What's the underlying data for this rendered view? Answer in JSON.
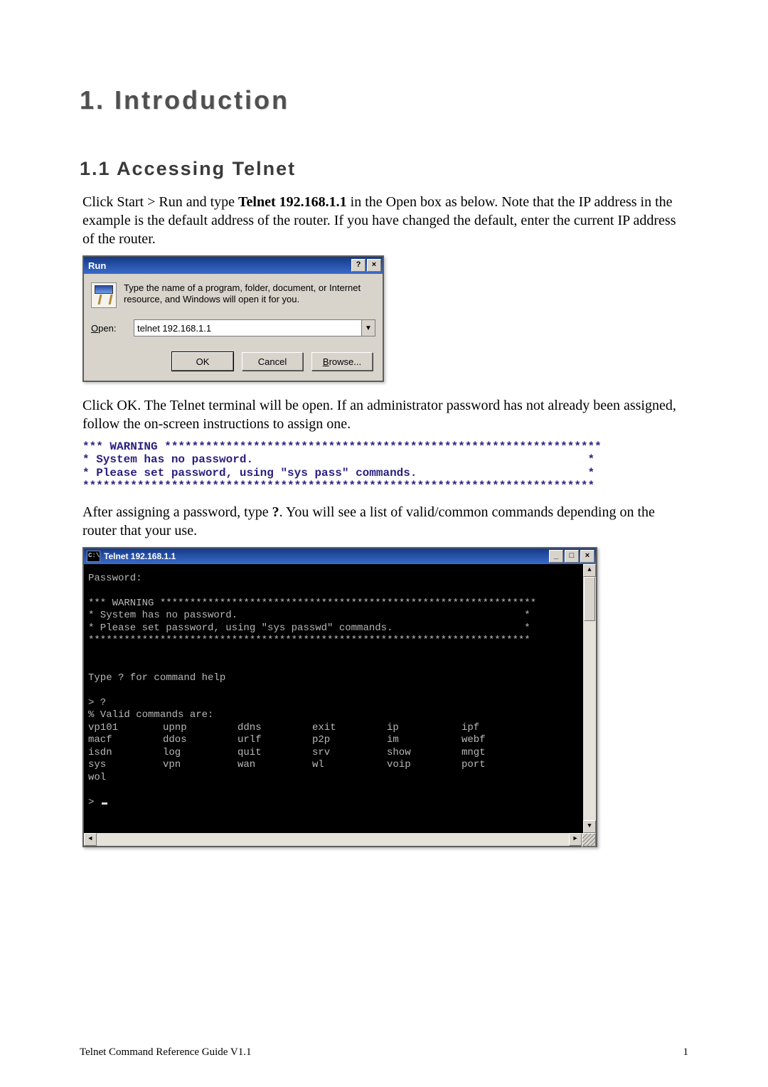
{
  "heading_chapter": "1. Introduction",
  "heading_section": "1.1 Accessing Telnet",
  "para1_pre": "Click Start > Run and type ",
  "para1_bold": "Telnet 192.168.1.1",
  "para1_post": " in the Open box as below. Note that the IP address in the example is the default address of the router. If you have changed the default, enter the current IP address of the router.",
  "run_dialog": {
    "title": "Run",
    "help_btn": "?",
    "close_btn": "×",
    "desc": "Type the name of a program, folder, document, or Internet resource, and Windows will open it for you.",
    "open_char": "O",
    "open_rest": "pen:",
    "input_value": "telnet 192.168.1.1",
    "dropdown_glyph": "▼",
    "btn_ok": "OK",
    "btn_cancel": "Cancel",
    "btn_browse_char": "B",
    "btn_browse_rest": "rowse..."
  },
  "para2": "Click OK. The Telnet terminal will be open. If an administrator password has not already been assigned, follow the on-screen instructions to assign one.",
  "warn_small": "*** WARNING ****************************************************************\n* System has no password.                                                 *\n* Please set password, using \"sys pass\" commands.                         *\n***************************************************************************",
  "para3_pre": "After assigning a password, type ",
  "para3_bold": "?",
  "para3_post": ". You will see a list of valid/common commands depending on the router that your use.",
  "console": {
    "icon_text": "C:\\",
    "title": "Telnet 192.168.1.1",
    "min_btn": "_",
    "max_btn": "□",
    "close_btn": "×",
    "scroll_up": "▲",
    "scroll_down": "▼",
    "scroll_left": "◄",
    "scroll_right": "►",
    "line_password": "Password:",
    "warn_top": "*** WARNING ***************************************************************",
    "warn_l1": "* System has no password.                                                *",
    "warn_l2": "* Please set password, using \"sys passwd\" commands.                      *",
    "warn_bot": "**************************************************************************",
    "help_hint": "Type ? for command help",
    "prompt1": "> ?",
    "valid_hdr": "% Valid commands are:",
    "rows": [
      [
        "vp101",
        "upnp",
        "ddns",
        "exit",
        "ip",
        "ipf"
      ],
      [
        "macf",
        "ddos",
        "urlf",
        "p2p",
        "im",
        "webf"
      ],
      [
        "isdn",
        "log",
        "quit",
        "srv",
        "show",
        "mngt"
      ],
      [
        "sys",
        "vpn",
        "wan",
        "wl",
        "voip",
        "port"
      ],
      [
        "wol",
        "",
        "",
        "",
        "",
        ""
      ]
    ],
    "prompt2": "> "
  },
  "footer_left": "Telnet Command Reference Guide V1.1",
  "footer_right": "1"
}
